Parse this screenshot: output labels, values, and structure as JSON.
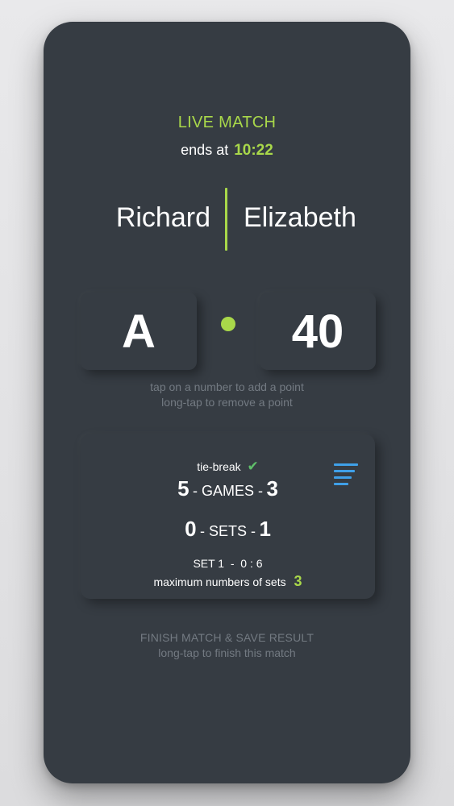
{
  "header": {
    "status": "LIVE MATCH",
    "ends_label": "ends at",
    "ends_time": "10:22"
  },
  "players": {
    "left": "Richard",
    "right": "Elizabeth"
  },
  "score": {
    "left": "A",
    "right": "40"
  },
  "hints": {
    "line1": "tap on a number to add a point",
    "line2": "long-tap to remove a point"
  },
  "stats": {
    "tiebreak_label": "tie-break",
    "games_left": "5",
    "games_label": "- GAMES -",
    "games_right": "3",
    "sets_left": "0",
    "sets_label": "- SETS -",
    "sets_right": "1",
    "set_info": "SET 1  -  0 : 6",
    "max_sets_label": "maximum numbers of sets",
    "max_sets_value": "3"
  },
  "finish": {
    "title": "FINISH MATCH & SAVE RESULT",
    "subtitle": "long-tap to finish this match"
  },
  "colors": {
    "background": "#363c43",
    "accent": "#a9d84a",
    "check": "#5fbf6a",
    "icon": "#3fa0e8"
  },
  "icons": {
    "serve_indicator": "serve-dot-icon",
    "tiebreak": "check-icon",
    "history": "list-icon"
  }
}
